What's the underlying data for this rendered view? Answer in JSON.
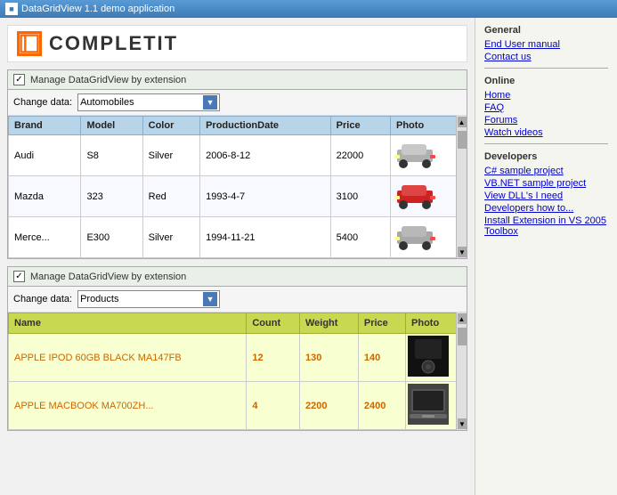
{
  "window": {
    "title": "DataGridView 1.1 demo application"
  },
  "logo": {
    "bracket": "[",
    "text": "COMPLETIT"
  },
  "automobiles_section": {
    "checkbox_label": "Manage DataGridView by extension",
    "change_data_label": "Change data:",
    "dropdown_value": "Automobiles",
    "columns": [
      "Brand",
      "Model",
      "Color",
      "ProductionDate",
      "Price",
      "Photo"
    ],
    "rows": [
      {
        "brand": "Audi",
        "model": "S8",
        "color": "Silver",
        "production_date": "2006-8-12",
        "price": "22000"
      },
      {
        "brand": "Mazda",
        "model": "323",
        "color": "Red",
        "production_date": "1993-4-7",
        "price": "3100"
      },
      {
        "brand": "Merce...",
        "model": "E300",
        "color": "Silver",
        "production_date": "1994-11-21",
        "price": "5400"
      }
    ]
  },
  "products_section": {
    "checkbox_label": "Manage DataGridView by extension",
    "change_data_label": "Change data:",
    "dropdown_value": "Products",
    "columns": [
      "Name",
      "Count",
      "Weight",
      "Price",
      "Photo"
    ],
    "rows": [
      {
        "name": "APPLE IPOD 60GB BLACK MA147FB",
        "count": "12",
        "weight": "130",
        "price": "140"
      },
      {
        "name": "APPLE MACBOOK MA700ZH...",
        "count": "4",
        "weight": "2200",
        "price": "2400"
      }
    ]
  },
  "sidebar": {
    "sections": [
      {
        "title": "General",
        "links": [
          "End User manual",
          "Contact us"
        ]
      },
      {
        "title": "Online",
        "links": [
          "Home",
          "FAQ",
          "Forums",
          "Watch videos"
        ]
      },
      {
        "title": "Developers",
        "links": [
          "C# sample project",
          "VB.NET sample project",
          "View DLL's I need",
          "Developers how to...",
          "Install Extension in VS 2005 Toolbox"
        ]
      }
    ]
  }
}
